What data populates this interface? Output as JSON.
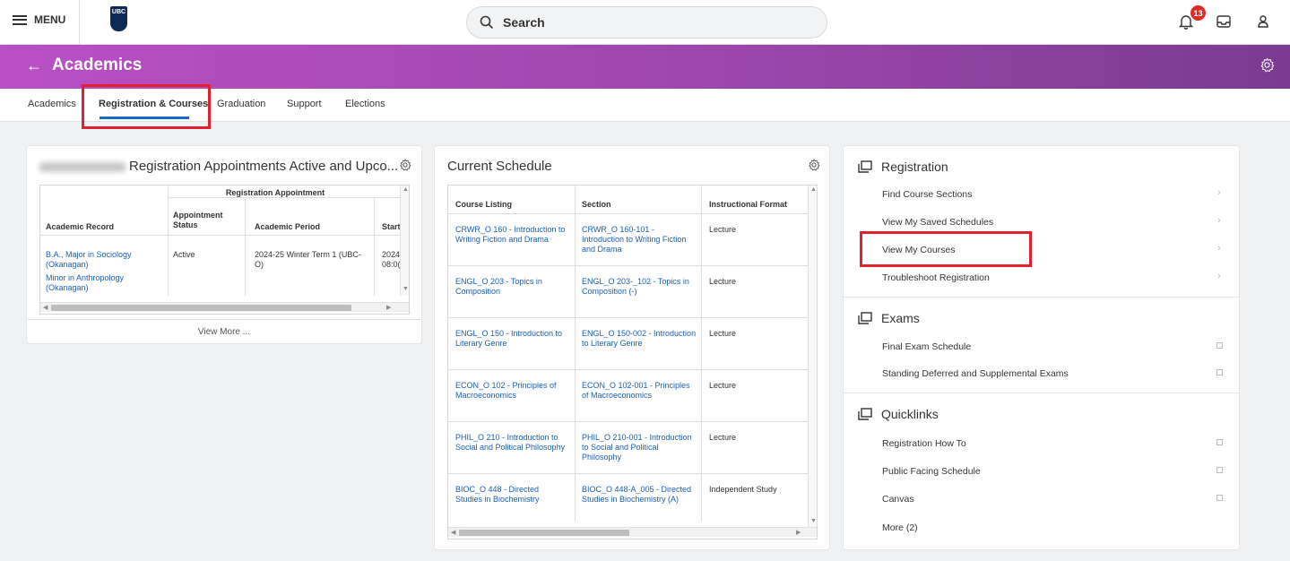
{
  "topbar": {
    "menu_label": "MENU",
    "logo_text": "UBC",
    "search_placeholder": "Search",
    "notification_count": "13"
  },
  "header": {
    "title": "Academics"
  },
  "tabs": [
    "Academics",
    "Registration & Courses",
    "Graduation",
    "Support",
    "Elections"
  ],
  "registration_card": {
    "title": "Registration Appointments Active and Upco...",
    "group_header": "Registration Appointment",
    "columns": [
      "Academic Record",
      "Appointment Status",
      "Academic Period",
      "Start"
    ],
    "row": {
      "records": [
        "B.A., Major in Sociology (Okanagan)",
        "Minor in Anthropology (Okanagan)"
      ],
      "status": "Active",
      "period": "2024-25 Winter Term 1 (UBC-O)",
      "start": "2024 08:0("
    },
    "view_more": "View More ..."
  },
  "schedule_card": {
    "title": "Current Schedule",
    "columns": [
      "Course Listing",
      "Section",
      "Instructional Format"
    ],
    "rows": [
      {
        "course": "CRWR_O 160 - Introduction to Writing Fiction and Drama",
        "section": "CRWR_O 160-101 - Introduction to Writing Fiction and Drama",
        "format": "Lecture"
      },
      {
        "course": "ENGL_O 203 - Topics in Composition",
        "section": "ENGL_O 203-_102 - Topics in Composition (-)",
        "format": "Lecture"
      },
      {
        "course": "ENGL_O 150 - Introduction to Literary Genre",
        "section": "ENGL_O 150-002 - Introduction to Literary Genre",
        "format": "Lecture"
      },
      {
        "course": "ECON_O 102 - Principles of Macroeconomics",
        "section": "ECON_O 102-001 - Principles of Macroeconomics",
        "format": "Lecture"
      },
      {
        "course": "PHIL_O 210 - Introduction to Social and Political Philosophy",
        "section": "PHIL_O 210-001 - Introduction to Social and Political Philosophy",
        "format": "Lecture"
      },
      {
        "course": "BIOC_O 448 - Directed Studies in Biochemistry",
        "section": "BIOC_O 448-A_005 - Directed Studies in Biochemistry (A)",
        "format": "Independent Study"
      }
    ]
  },
  "right_panel": {
    "registration": {
      "title": "Registration",
      "items": [
        "Find Course Sections",
        "View My Saved Schedules",
        "View My Courses",
        "Troubleshoot Registration"
      ]
    },
    "exams": {
      "title": "Exams",
      "items": [
        "Final Exam Schedule",
        "Standing Deferred and Supplemental Exams"
      ]
    },
    "quicklinks": {
      "title": "Quicklinks",
      "items": [
        "Registration How To",
        "Public Facing Schedule",
        "Canvas",
        "More (2)"
      ]
    }
  },
  "colors": {
    "header_gradient_start": "#b950c4",
    "header_gradient_end": "#7b3b90",
    "link": "#1a5fb4",
    "highlight": "#e5202e",
    "badge": "#de2d26",
    "tab_underline": "#1b66c9"
  }
}
